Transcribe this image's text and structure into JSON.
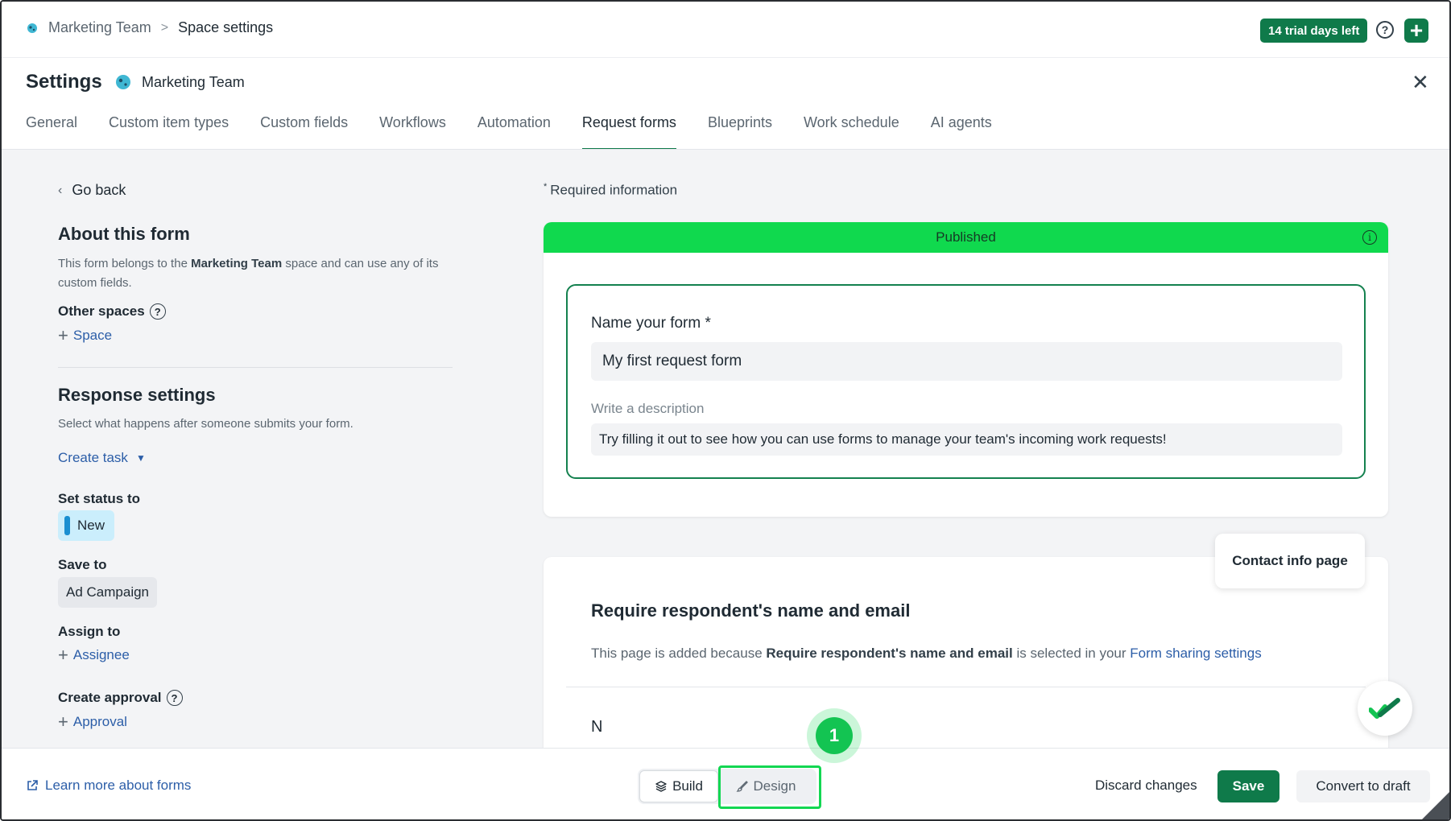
{
  "breadcrumb": {
    "space": "Marketing Team",
    "separator": ">",
    "current": "Space settings"
  },
  "topbar": {
    "trial": "14 trial days left",
    "help_icon": "question-circle-icon",
    "add_icon": "plus-icon"
  },
  "settings": {
    "title": "Settings",
    "space_name": "Marketing Team",
    "close_icon": "close-icon"
  },
  "tabs": [
    {
      "label": "General",
      "active": false
    },
    {
      "label": "Custom item types",
      "active": false
    },
    {
      "label": "Custom fields",
      "active": false
    },
    {
      "label": "Workflows",
      "active": false
    },
    {
      "label": "Automation",
      "active": false
    },
    {
      "label": "Request forms",
      "active": true
    },
    {
      "label": "Blueprints",
      "active": false
    },
    {
      "label": "Work schedule",
      "active": false
    },
    {
      "label": "AI agents",
      "active": false
    }
  ],
  "left": {
    "go_back": "Go back",
    "about_title": "About this form",
    "about_pre": "This form belongs to the ",
    "about_space": "Marketing Team",
    "about_post": " space and can use any of its custom fields.",
    "other_spaces": "Other spaces",
    "add_space": "Space",
    "response_title": "Response settings",
    "response_desc": "Select what happens after someone submits your form.",
    "create_task": "Create task",
    "set_status_label": "Set status to",
    "status_value": "New",
    "save_to_label": "Save to",
    "save_to_value": "Ad Campaign",
    "assign_to_label": "Assign to",
    "add_assignee": "Assignee",
    "create_approval_label": "Create approval",
    "add_approval": "Approval"
  },
  "form": {
    "required_mark": "*",
    "required_info": "Required information",
    "status_banner": "Published",
    "name_label": "Name your form *",
    "name_value": "My first request form",
    "desc_label": "Write a description",
    "desc_value": "Try filling it out to see how you can use forms to manage your team's incoming work requests!"
  },
  "contact": {
    "page_label": "Contact info page",
    "title": "Require respondent's name and email",
    "desc_pre": "This page is added because ",
    "desc_bold": "Require respondent's name and email",
    "desc_mid": " is selected in your ",
    "desc_link": "Form sharing settings",
    "peek": "N"
  },
  "bottombar": {
    "learn_more": "Learn more about forms",
    "build": "Build",
    "design": "Design",
    "discard": "Discard changes",
    "save": "Save",
    "convert": "Convert to draft"
  },
  "annotation": {
    "step": "1"
  },
  "colors": {
    "brand_green": "#0f7a4a",
    "published_green": "#10d94e",
    "highlight_green": "#13d752",
    "link_blue": "#2c5ea8",
    "status_blue": "#cbeefc"
  }
}
